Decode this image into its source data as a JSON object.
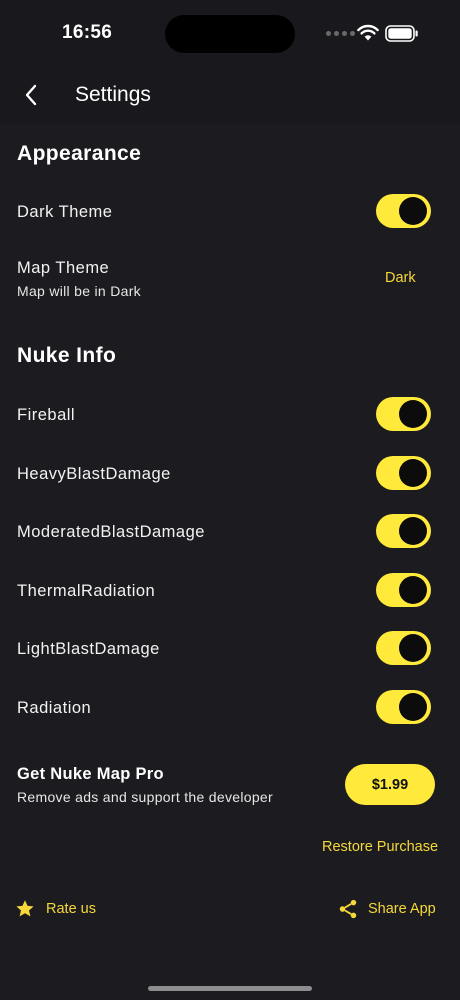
{
  "status_bar": {
    "time": "16:56"
  },
  "header": {
    "title": "Settings"
  },
  "appearance": {
    "section_title": "Appearance",
    "dark_theme": {
      "label": "Dark Theme",
      "on": true
    },
    "map_theme": {
      "label": "Map Theme",
      "sublabel": "Map will be in Dark",
      "value": "Dark"
    }
  },
  "nuke_info": {
    "section_title": "Nuke Info",
    "items": [
      {
        "label": "Fireball",
        "on": true
      },
      {
        "label": "HeavyBlastDamage",
        "on": true
      },
      {
        "label": "ModeratedBlastDamage",
        "on": true
      },
      {
        "label": "ThermalRadiation",
        "on": true
      },
      {
        "label": "LightBlastDamage",
        "on": true
      },
      {
        "label": "Radiation",
        "on": true
      }
    ]
  },
  "pro": {
    "title": "Get Nuke Map Pro",
    "subtitle": "Remove ads and support the developer",
    "price": "$1.99",
    "restore_label": "Restore Purchase"
  },
  "footer": {
    "rate_label": "Rate us",
    "rate_icon": "star-icon",
    "share_label": "Share App",
    "share_icon": "share-icon"
  },
  "colors": {
    "background": "#1c1b1f",
    "accent": "#ffea3b",
    "accent_text": "#f5d83a"
  }
}
